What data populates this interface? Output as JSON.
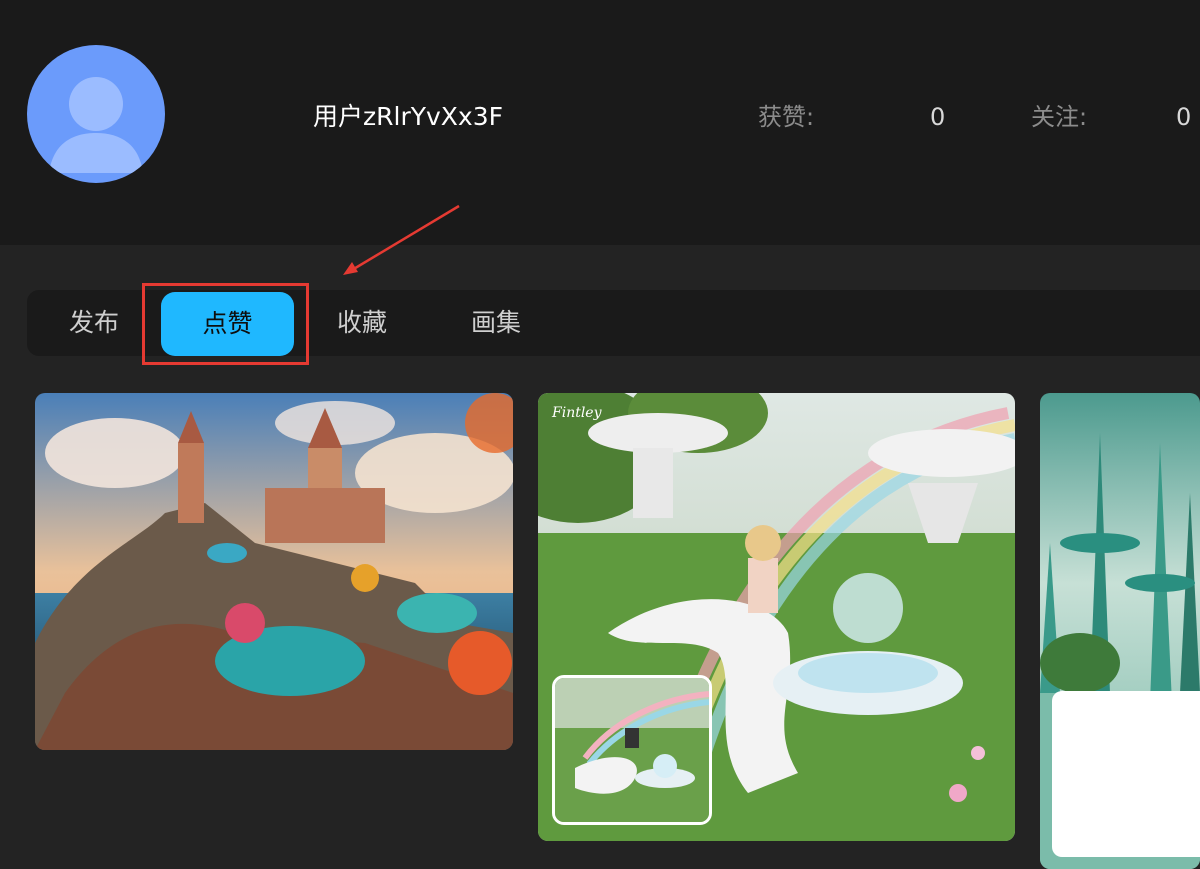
{
  "profile": {
    "username": "用户zRlrYvXx3F",
    "stats": [
      {
        "label": "获赞:",
        "value": "0"
      },
      {
        "label": "关注:",
        "value": "0"
      }
    ]
  },
  "tabs": [
    {
      "label": "发布",
      "active": false
    },
    {
      "label": "点赞",
      "active": true
    },
    {
      "label": "收藏",
      "active": false
    },
    {
      "label": "画集",
      "active": false
    }
  ],
  "colors": {
    "accent": "#1fb8ff",
    "annotation": "#e53a32",
    "avatar": "#6b9bfb"
  },
  "gallery": [
    {
      "kind": "fantasy-island-castle-image"
    },
    {
      "kind": "rainbow-park-girl-image",
      "watermark_text": "Fintley"
    },
    {
      "kind": "futuristic-towers-image"
    }
  ]
}
